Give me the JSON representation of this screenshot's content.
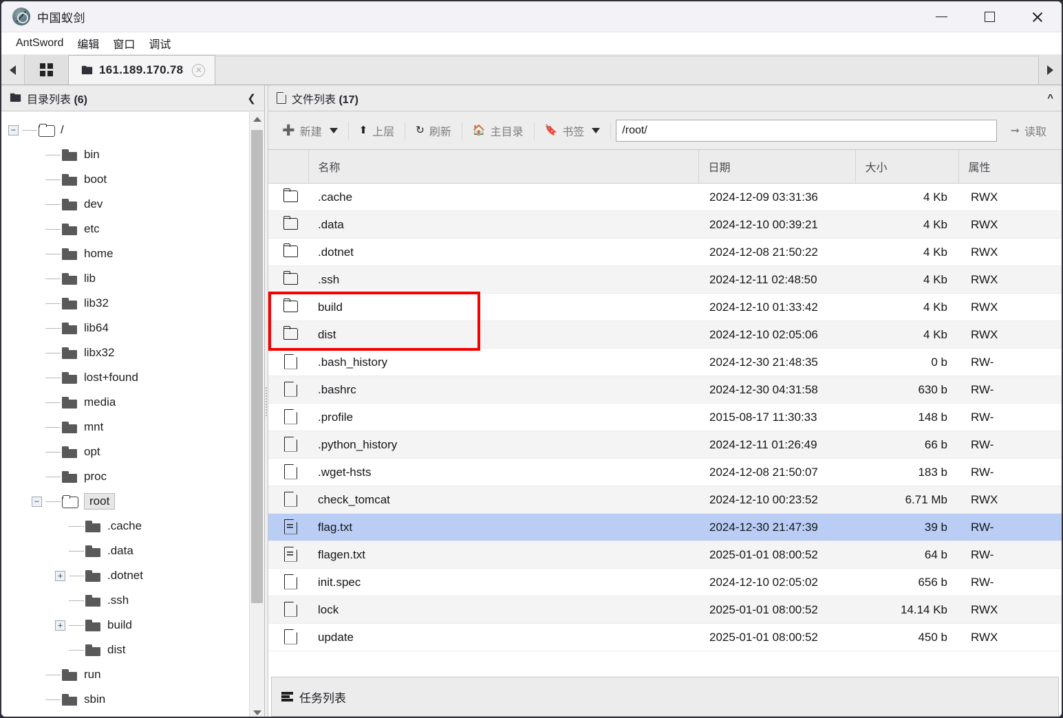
{
  "window": {
    "title": "中国蚁剑",
    "app_icon": "antsword-logo-icon",
    "minimize": "−",
    "maximize": "□",
    "close": "✕"
  },
  "menubar": {
    "items": [
      {
        "label": "AntSword"
      },
      {
        "label": "编辑"
      },
      {
        "label": "窗口"
      },
      {
        "label": "调试"
      }
    ]
  },
  "tabbar": {
    "scroll_left_icon": "triangle-left-icon",
    "scroll_right_icon": "triangle-right-icon",
    "home_tab_icon": "grid-apps-icon",
    "tabs": [
      {
        "label": "161.189.170.78",
        "icon": "folder-icon",
        "close": "✕",
        "active": true
      }
    ]
  },
  "sidebar": {
    "title_text": "目录列表 ",
    "title_count": "(6)",
    "collapse_icon": "chevron-left-icon",
    "folder_icon": "folder-icon",
    "tree": [
      {
        "label": "/",
        "depth": 0,
        "twist": "−",
        "icon": "folder-open-icon",
        "selected": false
      },
      {
        "label": "bin",
        "depth": 1,
        "twist": "",
        "icon": "folder-solid-icon",
        "selected": false
      },
      {
        "label": "boot",
        "depth": 1,
        "twist": "",
        "icon": "folder-solid-icon",
        "selected": false
      },
      {
        "label": "dev",
        "depth": 1,
        "twist": "",
        "icon": "folder-solid-icon",
        "selected": false
      },
      {
        "label": "etc",
        "depth": 1,
        "twist": "",
        "icon": "folder-solid-icon",
        "selected": false
      },
      {
        "label": "home",
        "depth": 1,
        "twist": "",
        "icon": "folder-solid-icon",
        "selected": false
      },
      {
        "label": "lib",
        "depth": 1,
        "twist": "",
        "icon": "folder-solid-icon",
        "selected": false
      },
      {
        "label": "lib32",
        "depth": 1,
        "twist": "",
        "icon": "folder-solid-icon",
        "selected": false
      },
      {
        "label": "lib64",
        "depth": 1,
        "twist": "",
        "icon": "folder-solid-icon",
        "selected": false
      },
      {
        "label": "libx32",
        "depth": 1,
        "twist": "",
        "icon": "folder-solid-icon",
        "selected": false
      },
      {
        "label": "lost+found",
        "depth": 1,
        "twist": "",
        "icon": "folder-solid-icon",
        "selected": false
      },
      {
        "label": "media",
        "depth": 1,
        "twist": "",
        "icon": "folder-solid-icon",
        "selected": false
      },
      {
        "label": "mnt",
        "depth": 1,
        "twist": "",
        "icon": "folder-solid-icon",
        "selected": false
      },
      {
        "label": "opt",
        "depth": 1,
        "twist": "",
        "icon": "folder-solid-icon",
        "selected": false
      },
      {
        "label": "proc",
        "depth": 1,
        "twist": "",
        "icon": "folder-solid-icon",
        "selected": false
      },
      {
        "label": "root",
        "depth": 1,
        "twist": "−",
        "icon": "folder-open-icon",
        "selected": true
      },
      {
        "label": ".cache",
        "depth": 2,
        "twist": "",
        "icon": "folder-solid-icon",
        "selected": false
      },
      {
        "label": ".data",
        "depth": 2,
        "twist": "",
        "icon": "folder-solid-icon",
        "selected": false
      },
      {
        "label": ".dotnet",
        "depth": 2,
        "twist": "+",
        "icon": "folder-solid-icon",
        "selected": false
      },
      {
        "label": ".ssh",
        "depth": 2,
        "twist": "",
        "icon": "folder-solid-icon",
        "selected": false
      },
      {
        "label": "build",
        "depth": 2,
        "twist": "+",
        "icon": "folder-solid-icon",
        "selected": false
      },
      {
        "label": "dist",
        "depth": 2,
        "twist": "",
        "icon": "folder-solid-icon",
        "selected": false
      },
      {
        "label": "run",
        "depth": 1,
        "twist": "",
        "icon": "folder-solid-icon",
        "selected": false
      },
      {
        "label": "sbin",
        "depth": 1,
        "twist": "",
        "icon": "folder-solid-icon",
        "selected": false
      }
    ]
  },
  "filepanel": {
    "title_text": "文件列表 ",
    "title_count": "(17)",
    "title_icon": "document-icon",
    "collapse_icon": "chevron-up-icon",
    "toolbar": {
      "new_label": "新建",
      "new_icon": "plus-circle-icon",
      "new_caret": "caret-down-icon",
      "up_label": "上层",
      "up_icon": "arrow-up-icon",
      "refresh_label": "刷新",
      "refresh_icon": "refresh-icon",
      "home_label": "主目录",
      "home_icon": "house-icon",
      "bookmark_label": "书签",
      "bookmark_icon": "bookmark-icon",
      "bookmark_caret": "caret-down-icon",
      "path_value": "/root/",
      "path_placeholder": "/root/",
      "read_label": "读取",
      "read_icon": "arrow-right-icon"
    },
    "columns": [
      "",
      "名称",
      "日期",
      "大小",
      "属性"
    ],
    "rows": [
      {
        "icon": "folder-icon",
        "name": ".cache",
        "date": "2024-12-09 03:31:36",
        "size": "4 Kb",
        "attr": "RWX"
      },
      {
        "icon": "folder-icon",
        "name": ".data",
        "date": "2024-12-10 00:39:21",
        "size": "4 Kb",
        "attr": "RWX"
      },
      {
        "icon": "folder-icon",
        "name": ".dotnet",
        "date": "2024-12-08 21:50:22",
        "size": "4 Kb",
        "attr": "RWX"
      },
      {
        "icon": "folder-icon",
        "name": ".ssh",
        "date": "2024-12-11 02:48:50",
        "size": "4 Kb",
        "attr": "RWX"
      },
      {
        "icon": "folder-icon",
        "name": "build",
        "date": "2024-12-10 01:33:42",
        "size": "4 Kb",
        "attr": "RWX"
      },
      {
        "icon": "folder-icon",
        "name": "dist",
        "date": "2024-12-10 02:05:06",
        "size": "4 Kb",
        "attr": "RWX"
      },
      {
        "icon": "file-icon",
        "name": ".bash_history",
        "date": "2024-12-30 21:48:35",
        "size": "0 b",
        "attr": "RW-"
      },
      {
        "icon": "file-icon",
        "name": ".bashrc",
        "date": "2024-12-30 04:31:58",
        "size": "630 b",
        "attr": "RW-"
      },
      {
        "icon": "file-icon",
        "name": ".profile",
        "date": "2015-08-17 11:30:33",
        "size": "148 b",
        "attr": "RW-"
      },
      {
        "icon": "file-icon",
        "name": ".python_history",
        "date": "2024-12-11 01:26:49",
        "size": "66 b",
        "attr": "RW-"
      },
      {
        "icon": "file-icon",
        "name": ".wget-hsts",
        "date": "2024-12-08 21:50:07",
        "size": "183 b",
        "attr": "RW-"
      },
      {
        "icon": "file-icon",
        "name": "check_tomcat",
        "date": "2024-12-10 00:23:52",
        "size": "6.71 Mb",
        "attr": "RWX"
      },
      {
        "icon": "text-file-icon",
        "name": "flag.txt",
        "date": "2024-12-30 21:47:39",
        "size": "39 b",
        "attr": "RW-",
        "selected": true
      },
      {
        "icon": "text-file-icon",
        "name": "flagen.txt",
        "date": "2025-01-01 08:00:52",
        "size": "64 b",
        "attr": "RW-"
      },
      {
        "icon": "file-icon",
        "name": "init.spec",
        "date": "2024-12-10 02:05:02",
        "size": "656 b",
        "attr": "RW-"
      },
      {
        "icon": "file-icon",
        "name": "lock",
        "date": "2025-01-01 08:00:52",
        "size": "14.14 Kb",
        "attr": "RWX"
      },
      {
        "icon": "file-icon",
        "name": "update",
        "date": "2025-01-01 08:00:52",
        "size": "450 b",
        "attr": "RWX"
      }
    ],
    "highlight": {
      "color": "#f60000",
      "rows": [
        "build",
        "dist"
      ]
    }
  },
  "taskbar": {
    "label": "任务列表",
    "icon": "list-icon"
  },
  "colors": {
    "selection": "#b9cdf5",
    "highlight_box": "#f60000",
    "toolbar_bg": "#ededed",
    "header_bg": "#ececec"
  }
}
